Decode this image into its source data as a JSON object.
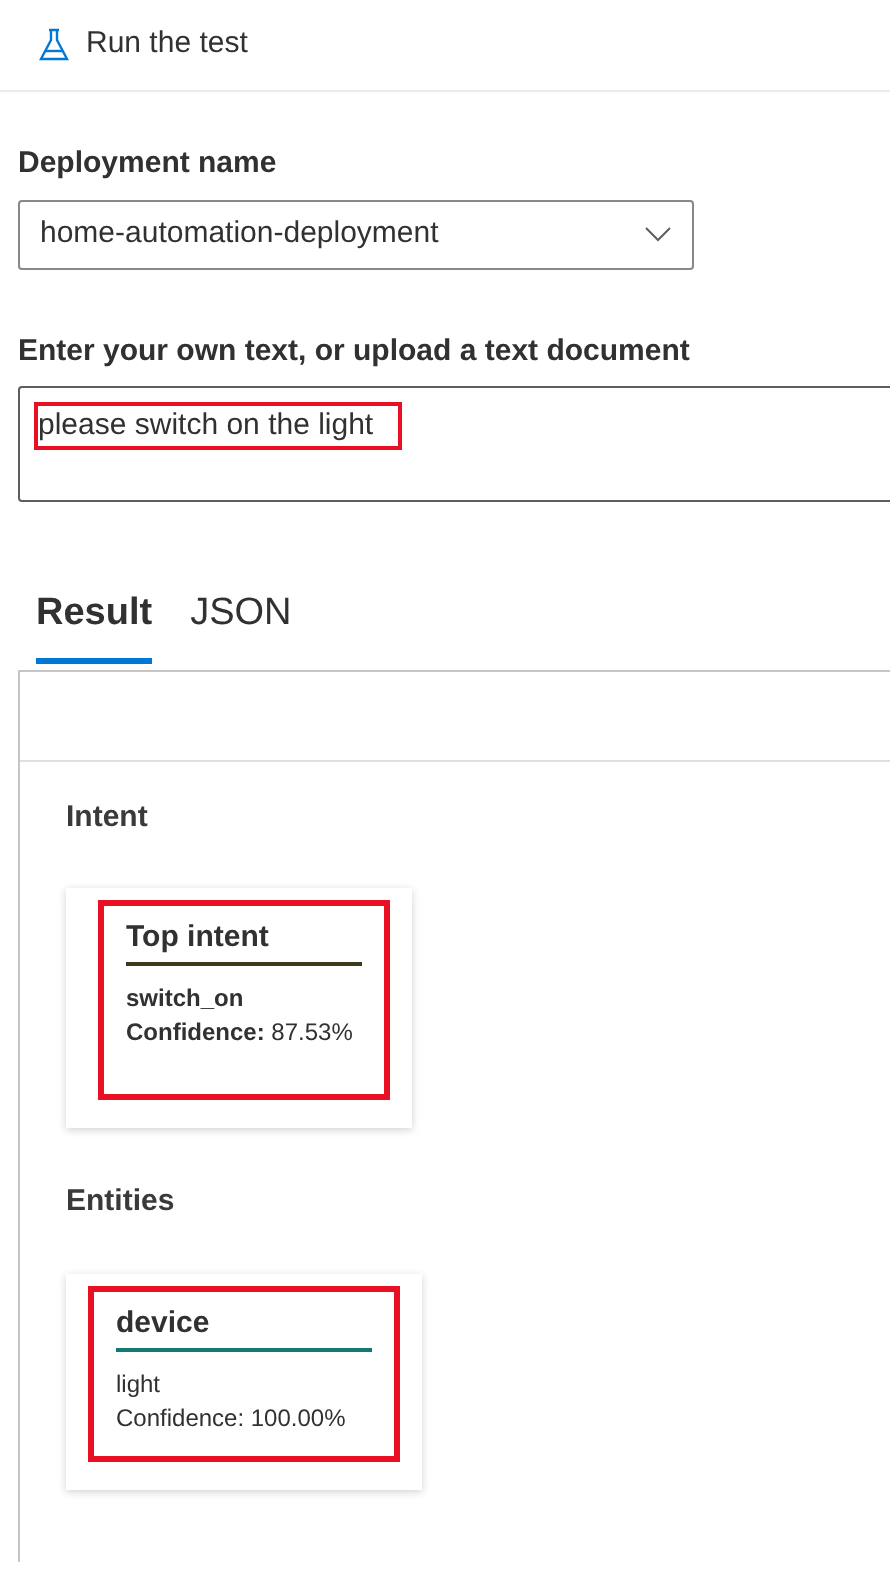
{
  "header": {
    "title": "Run the test"
  },
  "deployment": {
    "label": "Deployment name",
    "value": "home-automation-deployment"
  },
  "text_input": {
    "label": "Enter your own text, or upload a text document",
    "value": "please switch on the light",
    "highlighted": true
  },
  "tabs": [
    {
      "label": "Result",
      "selected": true
    },
    {
      "label": "JSON",
      "selected": false
    }
  ],
  "sections": [
    {
      "title": "Intent",
      "cards": [
        {
          "kind": "intent",
          "title": "Top intent",
          "color": "#3b3a1e",
          "value": "switch_on",
          "confidence": "**Confidence:** 87.53%",
          "highlighted": true
        }
      ]
    },
    {
      "title": "Entities",
      "cards": [
        {
          "kind": "entity",
          "title": "device",
          "color": "#117a74",
          "value": "light",
          "confidence": "Confidence: 100.00%",
          "highlighted": true
        }
      ]
    }
  ]
}
